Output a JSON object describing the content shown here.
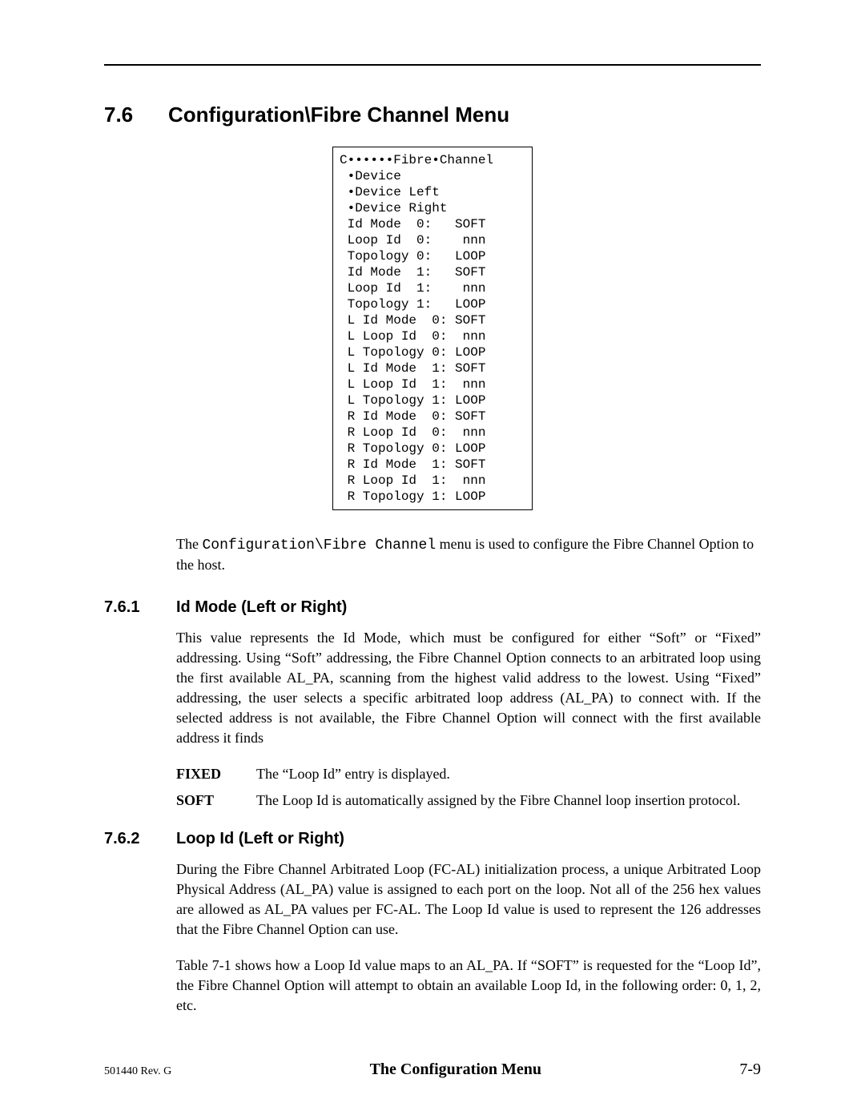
{
  "section": {
    "num": "7.6",
    "title": "Configuration\\Fibre Channel Menu"
  },
  "menu": {
    "lines": [
      "C••••••Fibre•Channel",
      " •Device",
      " •Device Left",
      " •Device Right",
      " Id Mode  0:   SOFT",
      " Loop Id  0:    nnn",
      " Topology 0:   LOOP",
      " Id Mode  1:   SOFT",
      " Loop Id  1:    nnn",
      " Topology 1:   LOOP",
      " L Id Mode  0: SOFT",
      " L Loop Id  0:  nnn",
      " L Topology 0: LOOP",
      " L Id Mode  1: SOFT",
      " L Loop Id  1:  nnn",
      " L Topology 1: LOOP",
      " R Id Mode  0: SOFT",
      " R Loop Id  0:  nnn",
      " R Topology 0: LOOP",
      " R Id Mode  1: SOFT",
      " R Loop Id  1:  nnn",
      " R Topology 1: LOOP"
    ]
  },
  "intro": {
    "pre": "The ",
    "mono": "Configuration\\Fibre Channel",
    "post": " menu is used to configure the Fibre Channel Option to the host."
  },
  "sub1": {
    "num": "7.6.1",
    "title": "Id Mode (Left or Right)",
    "para": "This value represents the Id Mode, which must be configured for either “Soft” or “Fixed” addressing. Using “Soft” addressing, the Fibre Channel Option connects to an arbitrated loop using the first available AL_PA, scanning from the highest valid ad­dress to the lowest. Using “Fixed” addressing, the user selects a specific arbitrated loop address (AL_PA) to connect with. If the selected address is not available, the Fi­bre Channel Option will connect with the first available address it finds",
    "defs": [
      {
        "term": "FIXED",
        "desc": "The “Loop Id” entry is displayed."
      },
      {
        "term": "SOFT",
        "desc": "The Loop Id is automatically assigned by the Fibre Channel loop insertion protocol."
      }
    ]
  },
  "sub2": {
    "num": "7.6.2",
    "title": "Loop Id (Left or Right)",
    "para1": "During the Fibre Channel Arbitrated Loop (FC-AL) initialization process, a unique Arbitrated Loop Physical Address (AL_PA) value is assigned to each port on the loop. Not all of the 256 hex values are allowed as AL_PA values per FC-AL. The Loop Id value is used to represent the 126 addresses that the Fibre Channel Option can use.",
    "para2": "Table 7-1 shows how a Loop Id value maps to an AL_PA. If “SOFT” is requested for the “Loop Id”, the Fibre Channel Option will attempt to obtain an available Loop Id, in the following order: 0, 1, 2, etc."
  },
  "footer": {
    "rev": "501440 Rev. G",
    "title": "The Configuration Menu",
    "page": "7-9"
  }
}
